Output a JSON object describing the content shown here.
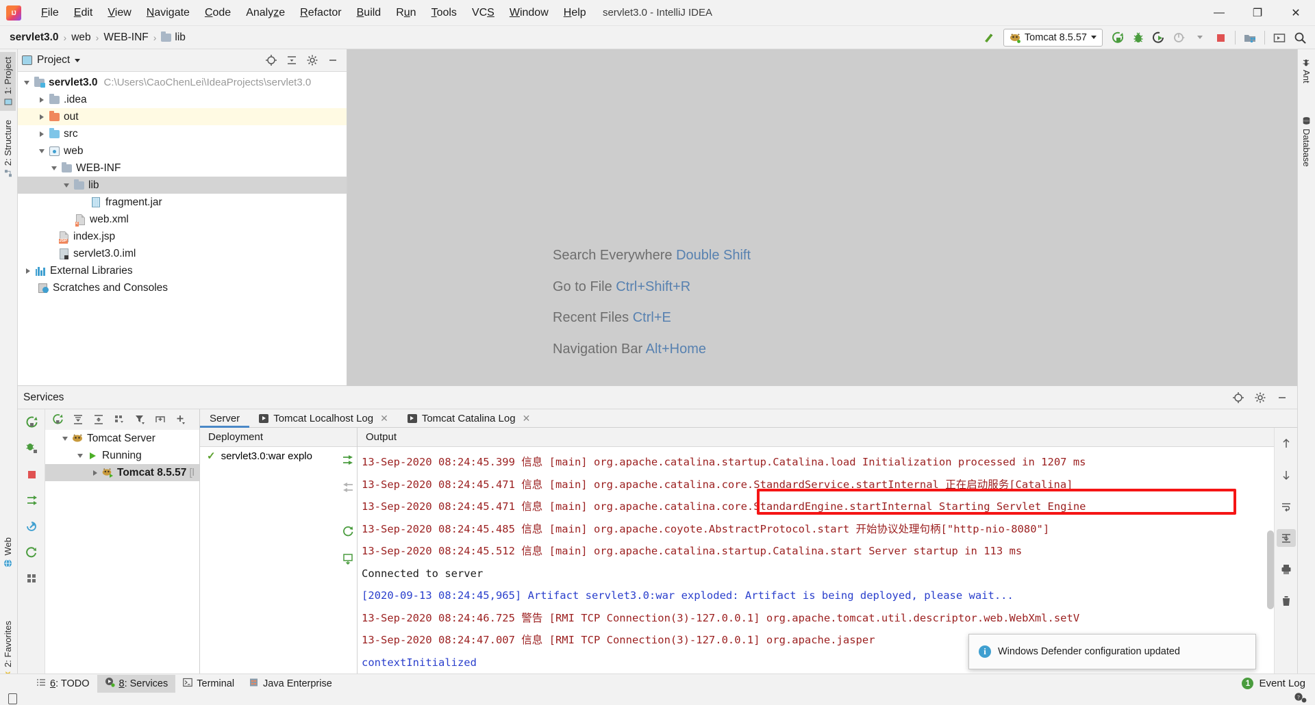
{
  "window": {
    "title": "servlet3.0 - IntelliJ IDEA",
    "logo_name": "intellij-idea-logo",
    "minimize": "—",
    "maximize": "❐",
    "close": "✕"
  },
  "menu": [
    {
      "label": "File"
    },
    {
      "label": "Edit"
    },
    {
      "label": "View"
    },
    {
      "label": "Navigate"
    },
    {
      "label": "Code"
    },
    {
      "label": "Analyze"
    },
    {
      "label": "Refactor"
    },
    {
      "label": "Build"
    },
    {
      "label": "Run"
    },
    {
      "label": "Tools"
    },
    {
      "label": "VCS"
    },
    {
      "label": "Window"
    },
    {
      "label": "Help"
    }
  ],
  "breadcrumb": [
    {
      "label": "servlet3.0",
      "bold": true,
      "icon": ""
    },
    {
      "label": "web",
      "bold": false,
      "icon": ""
    },
    {
      "label": "WEB-INF",
      "bold": false,
      "icon": ""
    },
    {
      "label": "lib",
      "bold": false,
      "icon": "folder-icon"
    }
  ],
  "toolbar": {
    "run_config": "Tomcat 8.5.57",
    "icons": [
      {
        "name": "hammer-build-icon"
      },
      {
        "name": "run-icon"
      },
      {
        "name": "debug-icon"
      },
      {
        "name": "run-with-coverage-icon"
      },
      {
        "name": "profile-icon"
      },
      {
        "name": "stop-icon"
      },
      {
        "name": "project-structure-icon"
      },
      {
        "name": "terminal-icon"
      },
      {
        "name": "search-icon"
      }
    ]
  },
  "left_tool_tabs": [
    {
      "label": "1: Project",
      "icon": "project-icon",
      "selected": true
    },
    {
      "label": "2: Structure",
      "icon": "structure-icon",
      "selected": false
    },
    {
      "label": "Web",
      "icon": "web-icon",
      "selected": false
    },
    {
      "label": "2: Favorites",
      "icon": "star-icon",
      "selected": false
    }
  ],
  "right_tool_tabs": [
    {
      "label": "Ant",
      "icon": "ant-icon"
    },
    {
      "label": "Database",
      "icon": "database-icon"
    }
  ],
  "project_panel": {
    "title": "Project",
    "header_icons": [
      {
        "name": "locate-target-icon"
      },
      {
        "name": "collapse-all-icon"
      },
      {
        "name": "settings-gear-icon"
      },
      {
        "name": "hide-panel-icon"
      }
    ],
    "tree": [
      {
        "label": "servlet3.0",
        "path": "C:\\Users\\CaoChenLei\\IdeaProjects\\servlet3.0",
        "indent": 0,
        "arrow": "down",
        "icon": "module-folder-icon",
        "bold": true,
        "state": ""
      },
      {
        "label": ".idea",
        "path": "",
        "indent": 1,
        "arrow": "right",
        "icon": "folder-gray-icon",
        "bold": false,
        "state": ""
      },
      {
        "label": "out",
        "path": "",
        "indent": 1,
        "arrow": "right",
        "icon": "folder-orange-icon",
        "bold": false,
        "state": "highlight"
      },
      {
        "label": "src",
        "path": "",
        "indent": 1,
        "arrow": "right",
        "icon": "folder-blue-icon",
        "bold": false,
        "state": ""
      },
      {
        "label": "web",
        "path": "",
        "indent": 1,
        "arrow": "down",
        "icon": "web-root-icon",
        "bold": false,
        "state": ""
      },
      {
        "label": "WEB-INF",
        "path": "",
        "indent": 2,
        "arrow": "down",
        "icon": "folder-gray-icon",
        "bold": false,
        "state": ""
      },
      {
        "label": "lib",
        "path": "",
        "indent": 3,
        "arrow": "down",
        "icon": "folder-gray-icon",
        "bold": false,
        "state": "selected"
      },
      {
        "label": "fragment.jar",
        "path": "",
        "indent": 5,
        "arrow": "none",
        "icon": "jar-icon",
        "bold": false,
        "state": ""
      },
      {
        "label": "web.xml",
        "path": "",
        "indent": 4,
        "arrow": "none",
        "icon": "xml-file-icon",
        "bold": false,
        "state": ""
      },
      {
        "label": "index.jsp",
        "path": "",
        "indent": 3,
        "arrow": "none",
        "icon": "jsp-file-icon",
        "bold": false,
        "state": ""
      },
      {
        "label": "servlet3.0.iml",
        "path": "",
        "indent": 2,
        "arrow": "none",
        "icon": "iml-file-icon",
        "bold": false,
        "state": ""
      },
      {
        "label": "External Libraries",
        "path": "",
        "indent": 0,
        "arrow": "right",
        "icon": "libraries-icon",
        "bold": false,
        "state": ""
      },
      {
        "label": "Scratches and Consoles",
        "path": "",
        "indent": 1,
        "arrow": "none",
        "icon": "scratches-icon",
        "bold": false,
        "state": ""
      }
    ]
  },
  "editor_hints": [
    {
      "action": "Search Everywhere",
      "shortcut": "Double Shift"
    },
    {
      "action": "Go to File",
      "shortcut": "Ctrl+Shift+R"
    },
    {
      "action": "Recent Files",
      "shortcut": "Ctrl+E"
    },
    {
      "action": "Navigation Bar",
      "shortcut": "Alt+Home"
    }
  ],
  "services": {
    "title": "Services",
    "header_icons": [
      {
        "name": "locate-target-icon"
      },
      {
        "name": "settings-gear-icon"
      },
      {
        "name": "hide-panel-icon"
      }
    ],
    "left_vtools": [
      {
        "name": "rerun-icon"
      },
      {
        "name": "connect-icon"
      },
      {
        "name": "stop-icon"
      },
      {
        "name": "redeploy-icon"
      },
      {
        "name": "update-icon"
      },
      {
        "name": "refresh-icon"
      },
      {
        "name": "grid-icon"
      }
    ],
    "tree_toolbar": [
      {
        "name": "rerun-icon"
      },
      {
        "name": "expand-all-icon"
      },
      {
        "name": "collapse-all-icon"
      },
      {
        "name": "group-icon"
      },
      {
        "name": "filter-icon"
      },
      {
        "name": "add-tab-icon"
      },
      {
        "name": "add-icon"
      }
    ],
    "tree": [
      {
        "label": "Tomcat Server",
        "indent": 0,
        "arrow": "down",
        "icon": "tomcat-icon",
        "bold": false,
        "state": ""
      },
      {
        "label": "Running",
        "indent": 1,
        "arrow": "down",
        "icon": "play-green-icon",
        "bold": false,
        "state": ""
      },
      {
        "label": "Tomcat 8.5.57",
        "suffix": "[l",
        "indent": 2,
        "arrow": "right",
        "icon": "tomcat-running-icon",
        "bold": true,
        "state": "selected"
      }
    ],
    "tabs": [
      {
        "label": "Server",
        "icon": "",
        "closable": false,
        "active": true
      },
      {
        "label": "Tomcat Localhost Log",
        "icon": "console-icon",
        "closable": true,
        "active": false
      },
      {
        "label": "Tomcat Catalina Log",
        "icon": "console-icon",
        "closable": true,
        "active": false
      }
    ],
    "deployment": {
      "header": "Deployment",
      "items": [
        {
          "label": "servlet3.0:war explo",
          "status": "check"
        }
      ],
      "tools": [
        {
          "name": "deploy-icon"
        },
        {
          "name": "undeploy-icon"
        },
        {
          "name": "redeploy-icon"
        },
        {
          "name": "update-resources-icon"
        }
      ]
    },
    "output": {
      "header": "Output",
      "lines": [
        {
          "text": "13-Sep-2020 08:24:45.399 信息 [main] org.apache.catalina.startup.Catalina.load Initialization processed in 1207 ms",
          "color": "red"
        },
        {
          "text": "13-Sep-2020 08:24:45.471 信息 [main] org.apache.catalina.core.StandardService.startInternal 正在启动服务[Catalina]",
          "color": "red"
        },
        {
          "text": "13-Sep-2020 08:24:45.471 信息 [main] org.apache.catalina.core.StandardEngine.startInternal Starting Servlet Engine",
          "color": "red"
        },
        {
          "text": "13-Sep-2020 08:24:45.485 信息 [main] org.apache.coyote.AbstractProtocol.start 开始协议处理句柄[\"http-nio-8080\"]",
          "color": "red"
        },
        {
          "text": "13-Sep-2020 08:24:45.512 信息 [main] org.apache.catalina.startup.Catalina.start Server startup in 113 ms",
          "color": "red"
        },
        {
          "text": "Connected to server",
          "color": "dark"
        },
        {
          "text": "[2020-09-13 08:24:45,965] Artifact servlet3.0:war exploded: Artifact is being deployed, please wait...",
          "color": "blue"
        },
        {
          "text": "13-Sep-2020 08:24:46.725 警告 [RMI TCP Connection(3)-127.0.0.1] org.apache.tomcat.util.descriptor.web.WebXml.setV",
          "color": "red"
        },
        {
          "text": "13-Sep-2020 08:24:47.007 信息 [RMI TCP Connection(3)-127.0.0.1] org.apache.jasper",
          "color": "red"
        },
        {
          "text": "contextInitialized",
          "color": "blue"
        }
      ],
      "right_tools": [
        {
          "name": "scroll-up-icon"
        },
        {
          "name": "scroll-down-icon"
        },
        {
          "name": "soft-wrap-icon"
        },
        {
          "name": "scroll-to-end-icon"
        },
        {
          "name": "print-icon"
        },
        {
          "name": "trash-icon"
        }
      ]
    },
    "annotation": {
      "name": "red-highlight-box",
      "color": "#f51515"
    }
  },
  "notification": {
    "icon": "info-icon",
    "message": "Windows Defender configuration updated"
  },
  "bottom_tabs": [
    {
      "label": "6: TODO",
      "icon": "todo-icon",
      "active": false
    },
    {
      "label": "8: Services",
      "icon": "services-icon",
      "active": true
    },
    {
      "label": "Terminal",
      "icon": "terminal-icon",
      "active": false
    },
    {
      "label": "Java Enterprise",
      "icon": "java-enterprise-icon",
      "active": false
    }
  ],
  "status": {
    "event_log": "Event Log",
    "event_count": "1",
    "memory_icon": "memory-indicator-icon",
    "help_icon": "help-settings-icon"
  }
}
